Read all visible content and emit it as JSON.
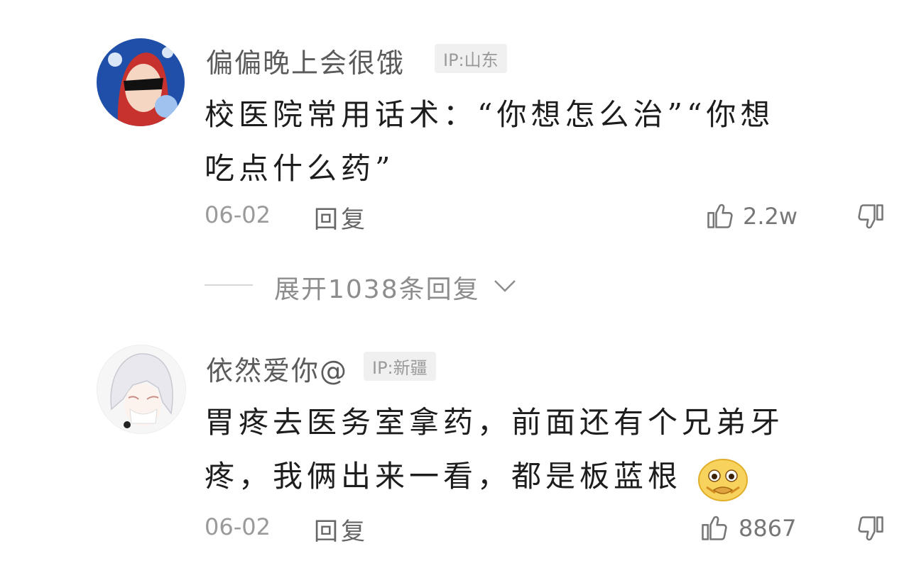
{
  "comments": [
    {
      "username": "偏偏晚上会很饿",
      "ip": "IP:山东",
      "body_lines": [
        "校医院常用话术：“你想怎么治”“你想",
        "吃点什么药”"
      ],
      "date": "06-02",
      "reply_label": "回复",
      "likes": "2.2w",
      "expand_label": "展开1038条回复"
    },
    {
      "username": "依然爱你@",
      "ip": "IP:新疆",
      "body_lines": [
        "胃疼去医务室拿药，前面还有个兄弟牙",
        "疼，我俩出来一看，都是板蓝根"
      ],
      "emoji": "pleading-face-emoji",
      "date": "06-02",
      "reply_label": "回复",
      "likes": "8867"
    }
  ],
  "icons": {
    "like": "thumbs-up-outline-icon",
    "dislike": "thumbs-down-outline-icon",
    "expand": "chevron-down-icon"
  },
  "colors": {
    "username": "#5b5b5b",
    "body": "#1d1d1d",
    "meta": "#9a9a9a",
    "ip_bg": "#f0f0f0"
  }
}
